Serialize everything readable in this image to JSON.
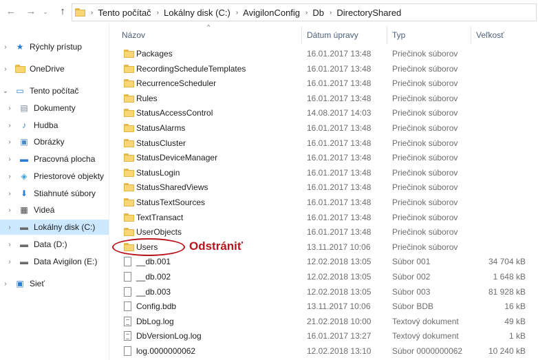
{
  "address_bar": {
    "path": [
      "Tento počítač",
      "Lokálny disk (C:)",
      "AvigilonConfig",
      "Db",
      "DirectoryShared"
    ]
  },
  "sidebar": {
    "items": [
      {
        "label": "Rýchly prístup",
        "icon": "star-icon",
        "chevron": "›",
        "indent": 0
      },
      {
        "label": "OneDrive",
        "icon": "folder-icon",
        "chevron": "›",
        "indent": 0
      },
      {
        "label": "Tento počítač",
        "icon": "monitor-icon",
        "chevron": "⌄",
        "indent": 0
      },
      {
        "label": "Dokumenty",
        "icon": "document-icon",
        "chevron": "›",
        "indent": 1
      },
      {
        "label": "Hudba",
        "icon": "music-icon",
        "chevron": "›",
        "indent": 1
      },
      {
        "label": "Obrázky",
        "icon": "pictures-icon",
        "chevron": "›",
        "indent": 1
      },
      {
        "label": "Pracovná plocha",
        "icon": "desktop-icon",
        "chevron": "›",
        "indent": 1
      },
      {
        "label": "Priestorové objekty",
        "icon": "cube-icon",
        "chevron": "›",
        "indent": 1
      },
      {
        "label": "Stiahnuté súbory",
        "icon": "download-icon",
        "chevron": "›",
        "indent": 1
      },
      {
        "label": "Videá",
        "icon": "video-icon",
        "chevron": "›",
        "indent": 1
      },
      {
        "label": "Lokálny disk (C:)",
        "icon": "drive-icon",
        "chevron": "›",
        "indent": 1,
        "selected": true
      },
      {
        "label": "Data (D:)",
        "icon": "drive-icon",
        "chevron": "›",
        "indent": 1
      },
      {
        "label": "Data Avigilon (E:)",
        "icon": "drive-icon",
        "chevron": "›",
        "indent": 1
      },
      {
        "label": "Sieť",
        "icon": "network-icon",
        "chevron": "›",
        "indent": 0
      }
    ]
  },
  "columns": {
    "name": "Názov",
    "date": "Dátum úpravy",
    "type": "Typ",
    "size": "Veľkosť"
  },
  "files": [
    {
      "name": "Packages",
      "date": "16.01.2017 13:48",
      "type": "Priečinok súborov",
      "size": "",
      "kind": "folder"
    },
    {
      "name": "RecordingScheduleTemplates",
      "date": "16.01.2017 13:48",
      "type": "Priečinok súborov",
      "size": "",
      "kind": "folder"
    },
    {
      "name": "RecurrenceScheduler",
      "date": "16.01.2017 13:48",
      "type": "Priečinok súborov",
      "size": "",
      "kind": "folder"
    },
    {
      "name": "Rules",
      "date": "16.01.2017 13:48",
      "type": "Priečinok súborov",
      "size": "",
      "kind": "folder"
    },
    {
      "name": "StatusAccessControl",
      "date": "14.08.2017 14:03",
      "type": "Priečinok súborov",
      "size": "",
      "kind": "folder"
    },
    {
      "name": "StatusAlarms",
      "date": "16.01.2017 13:48",
      "type": "Priečinok súborov",
      "size": "",
      "kind": "folder"
    },
    {
      "name": "StatusCluster",
      "date": "16.01.2017 13:48",
      "type": "Priečinok súborov",
      "size": "",
      "kind": "folder"
    },
    {
      "name": "StatusDeviceManager",
      "date": "16.01.2017 13:48",
      "type": "Priečinok súborov",
      "size": "",
      "kind": "folder"
    },
    {
      "name": "StatusLogin",
      "date": "16.01.2017 13:48",
      "type": "Priečinok súborov",
      "size": "",
      "kind": "folder"
    },
    {
      "name": "StatusSharedViews",
      "date": "16.01.2017 13:48",
      "type": "Priečinok súborov",
      "size": "",
      "kind": "folder"
    },
    {
      "name": "StatusTextSources",
      "date": "16.01.2017 13:48",
      "type": "Priečinok súborov",
      "size": "",
      "kind": "folder"
    },
    {
      "name": "TextTransact",
      "date": "16.01.2017 13:48",
      "type": "Priečinok súborov",
      "size": "",
      "kind": "folder"
    },
    {
      "name": "UserObjects",
      "date": "16.01.2017 13:48",
      "type": "Priečinok súborov",
      "size": "",
      "kind": "folder"
    },
    {
      "name": "Users",
      "date": "13.11.2017 10:06",
      "type": "Priečinok súborov",
      "size": "",
      "kind": "folder"
    },
    {
      "name": "__db.001",
      "date": "12.02.2018 13:05",
      "type": "Súbor 001",
      "size": "34 704 kB",
      "kind": "file"
    },
    {
      "name": "__db.002",
      "date": "12.02.2018 13:05",
      "type": "Súbor 002",
      "size": "1 648 kB",
      "kind": "file"
    },
    {
      "name": "__db.003",
      "date": "12.02.2018 13:05",
      "type": "Súbor 003",
      "size": "81 928 kB",
      "kind": "file"
    },
    {
      "name": "Config.bdb",
      "date": "13.11.2017 10:06",
      "type": "Súbor BDB",
      "size": "16 kB",
      "kind": "file"
    },
    {
      "name": "DbLog.log",
      "date": "21.02.2018 10:00",
      "type": "Textový dokument",
      "size": "49 kB",
      "kind": "text"
    },
    {
      "name": "DbVersionLog.log",
      "date": "16.01.2017 13:27",
      "type": "Textový dokument",
      "size": "1 kB",
      "kind": "text"
    },
    {
      "name": "log.0000000062",
      "date": "12.02.2018 13:10",
      "type": "Súbor 0000000062",
      "size": "10 240 kB",
      "kind": "file"
    }
  ],
  "annotation": {
    "label": "Odstrániť",
    "color": "#b8141b"
  }
}
